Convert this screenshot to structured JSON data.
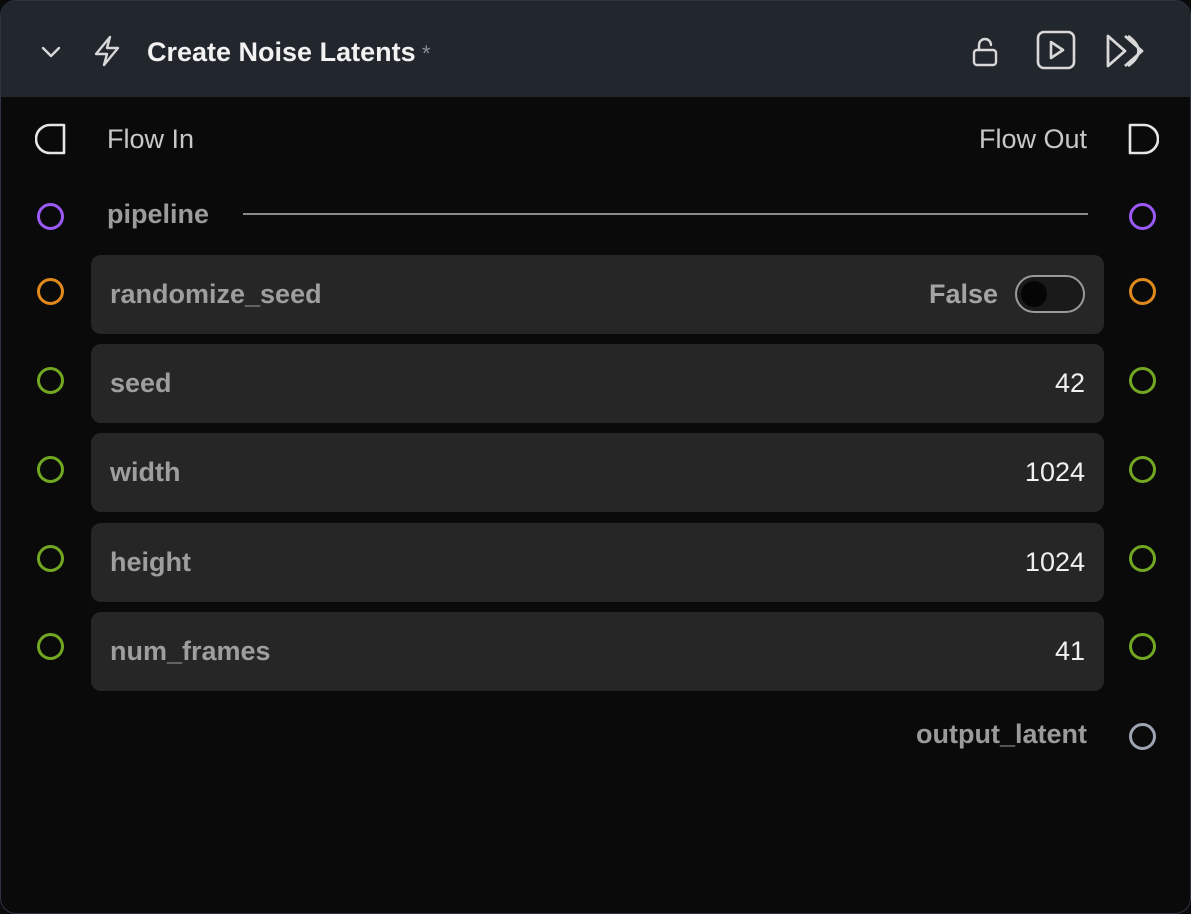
{
  "header": {
    "title": "Create Noise Latents",
    "dirty_marker": "*",
    "icons": {
      "collapse": "chevron-down-icon",
      "node_type": "lightning-bolt-icon",
      "lock": "unlock-icon",
      "run": "play-icon",
      "run_all": "fast-forward-icon"
    }
  },
  "flow": {
    "in_label": "Flow In",
    "out_label": "Flow Out"
  },
  "pipeline": {
    "label": "pipeline"
  },
  "params": {
    "randomize_seed": {
      "label": "randomize_seed",
      "value": "False"
    },
    "seed": {
      "label": "seed",
      "value": "42"
    },
    "width": {
      "label": "width",
      "value": "1024"
    },
    "height": {
      "label": "height",
      "value": "1024"
    },
    "num_frames": {
      "label": "num_frames",
      "value": "41"
    }
  },
  "output": {
    "label": "output_latent"
  },
  "colors": {
    "header_bg": "#22262d",
    "body_bg": "#0a0a0a",
    "field_bg": "#262626",
    "pipeline_port": "#9b59f6",
    "bool_port": "#e08a1e",
    "int_port": "#72a722",
    "output_port": "#9ea5b2"
  }
}
